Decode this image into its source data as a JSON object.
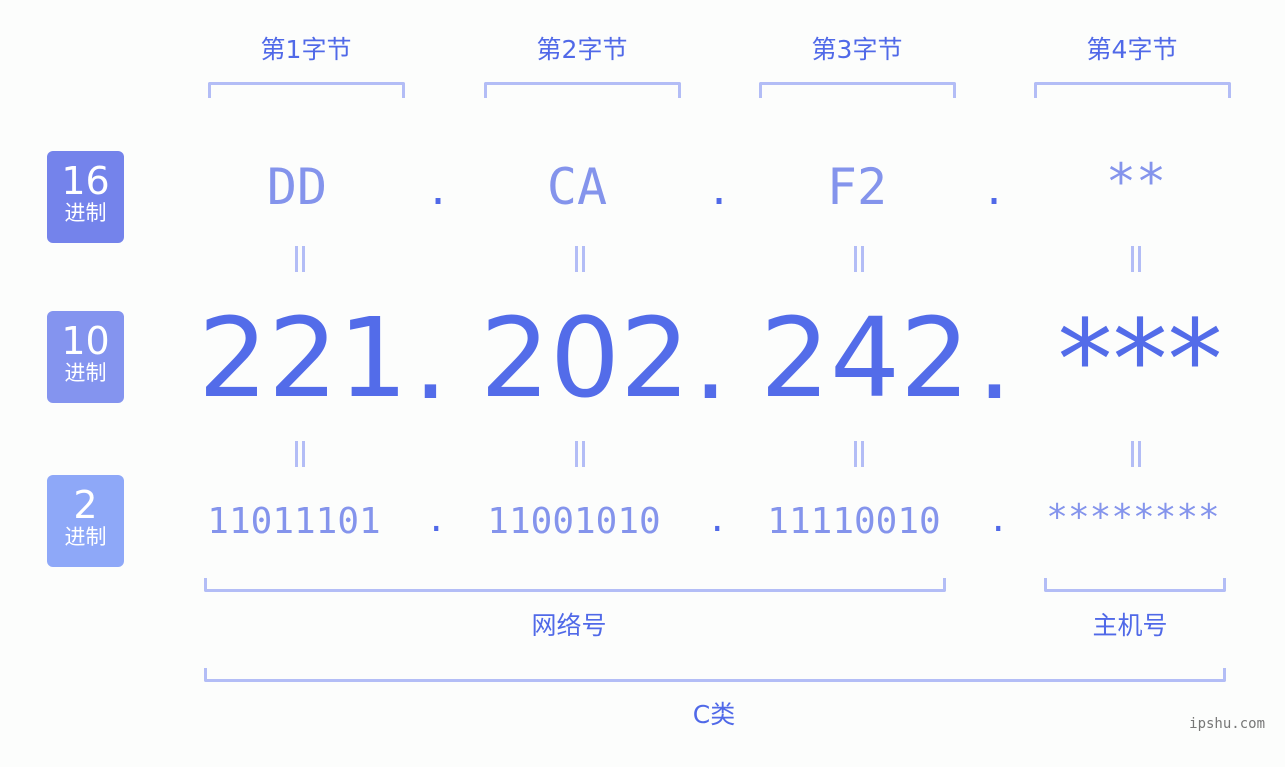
{
  "byte_headers": [
    "第1字节",
    "第2字节",
    "第3字节",
    "第4字节"
  ],
  "badges": {
    "hex": {
      "num": "16",
      "label": "进制",
      "color": "#7483eb"
    },
    "dec": {
      "num": "10",
      "label": "进制",
      "color": "#8494ef"
    },
    "bin": {
      "num": "2",
      "label": "进制",
      "color": "#8ea8f8"
    }
  },
  "hex_values": [
    "DD",
    "CA",
    "F2",
    "**"
  ],
  "dec_values": [
    "221",
    "202",
    "242",
    "***"
  ],
  "bin_values": [
    "11011101",
    "11001010",
    "11110010",
    "********"
  ],
  "separator": ".",
  "equals": "=",
  "groups": {
    "network": "网络号",
    "host": "主机号",
    "class": "C类"
  },
  "watermark": "ipshu.com",
  "colors": {
    "primary": "#536ce9",
    "light": "#8494ec",
    "bracket": "#b3bdf6"
  }
}
